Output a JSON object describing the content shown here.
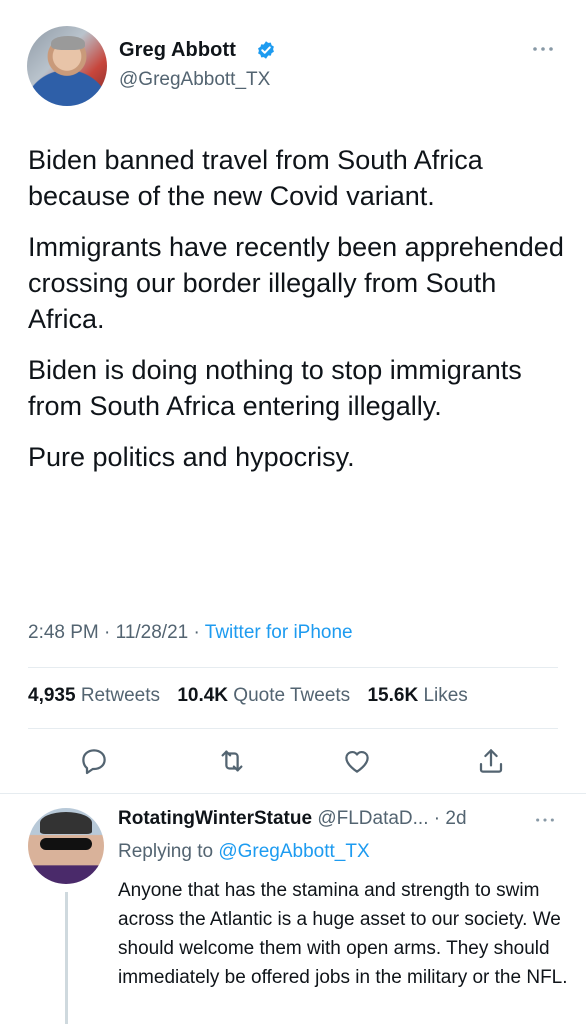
{
  "tweet": {
    "author_name": "Greg Abbott",
    "author_handle": "@GregAbbott_TX",
    "verified": true,
    "paragraphs": [
      "Biden banned travel from South Africa because of the new Covid variant.",
      "Immigrants have recently been apprehended crossing our border illegally from South Africa.",
      "Biden is doing nothing to stop immigrants from South Africa entering illegally.",
      "Pure politics and hypocrisy."
    ],
    "time": "2:48 PM",
    "date": "11/28/21",
    "source": "Twitter for iPhone",
    "retweets_count": "4,935",
    "retweets_label": "Retweets",
    "quote_count": "10.4K",
    "quote_label": "Quote Tweets",
    "likes_count": "15.6K",
    "likes_label": "Likes"
  },
  "actions": {
    "reply_icon": "reply-icon",
    "retweet_icon": "retweet-icon",
    "like_icon": "heart-icon",
    "share_icon": "share-icon"
  },
  "reply": {
    "author_name": "RotatingWinterStatue",
    "author_handle": "@FLDataD...",
    "age": "· 2d",
    "replying_prefix": "Replying to",
    "replying_to": "@GregAbbott_TX",
    "text": "Anyone that has the stamina and strength to swim across the Atlantic is a huge asset to our society.  We should welcome them with open arms.  They should immediately be offered jobs in the military or the NFL."
  },
  "colors": {
    "accent": "#1d9bf0",
    "secondary_text": "#536471",
    "primary_text": "#0f1419",
    "divider": "#e6ecf0"
  }
}
